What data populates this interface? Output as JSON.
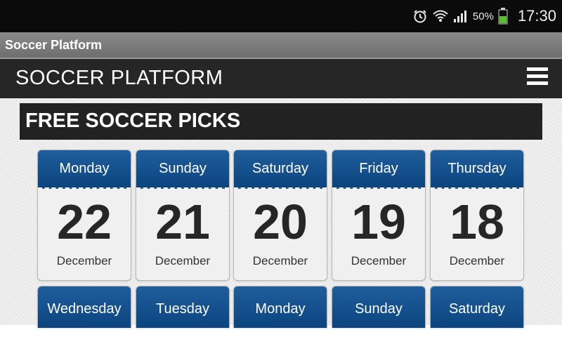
{
  "status_bar": {
    "icons": [
      "alarm-icon",
      "wifi-icon",
      "signal-icon",
      "battery-icon"
    ],
    "battery": "50%",
    "time": "17:30"
  },
  "app_bar": {
    "title": "Soccer Platform"
  },
  "site_header": {
    "brand": "SOCCER PLATFORM",
    "menu_icon": "hamburger-menu-icon"
  },
  "section": {
    "title": "FREE SOCCER PICKS"
  },
  "colors": {
    "card_header": "#0b447f",
    "header_bg": "#262626",
    "title_bg": "#222222"
  },
  "dates_row1": [
    {
      "day": "Monday",
      "date": "22",
      "month": "December"
    },
    {
      "day": "Sunday",
      "date": "21",
      "month": "December"
    },
    {
      "day": "Saturday",
      "date": "20",
      "month": "December"
    },
    {
      "day": "Friday",
      "date": "19",
      "month": "December"
    },
    {
      "day": "Thursday",
      "date": "18",
      "month": "December"
    }
  ],
  "dates_row2": [
    {
      "day": "Wednesday"
    },
    {
      "day": "Tuesday"
    },
    {
      "day": "Monday"
    },
    {
      "day": "Sunday"
    },
    {
      "day": "Saturday"
    }
  ]
}
